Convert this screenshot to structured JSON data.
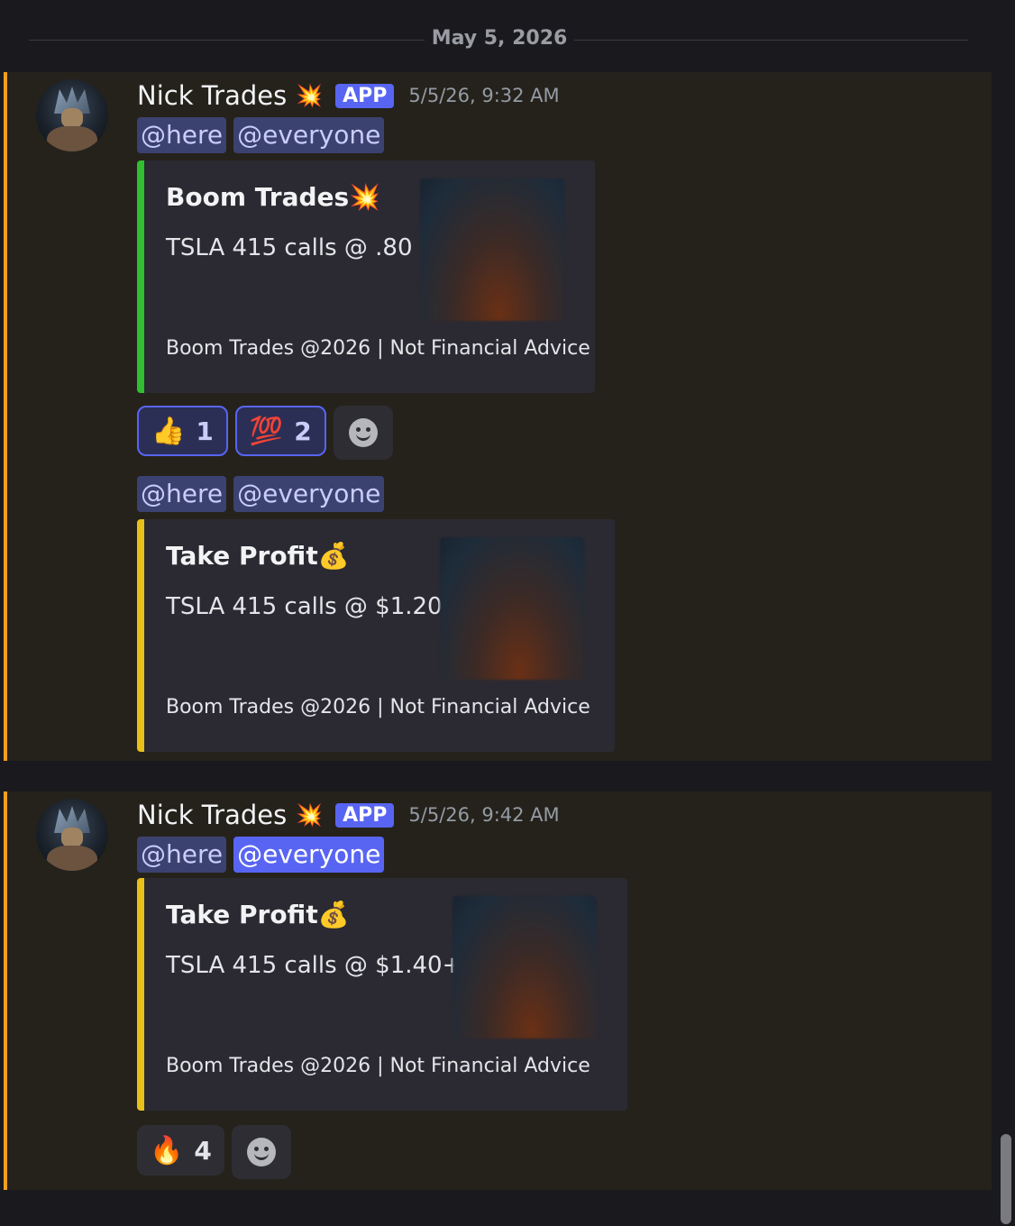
{
  "date_divider": "May 5, 2026",
  "messages": [
    {
      "author": "Nick Trades",
      "author_emoji": "💥",
      "badge": "APP",
      "timestamp": "5/5/26, 9:32 AM",
      "posts": [
        {
          "mentions": [
            "@here",
            "@everyone"
          ],
          "embed": {
            "title": "Boom Trades💥",
            "description": "TSLA 415 calls @ .80",
            "footer": "Boom Trades @2026 | Not Financial Advice",
            "color": "#2fbf2f"
          },
          "reactions": [
            {
              "emoji": "👍",
              "emoji_name": "thumbs-up-icon",
              "count": "1"
            },
            {
              "emoji": "💯",
              "emoji_name": "hundred-points-icon",
              "count": "2"
            }
          ]
        },
        {
          "mentions": [
            "@here",
            "@everyone"
          ],
          "embed": {
            "title": "Take Profit💰",
            "description": "TSLA 415 calls @ $1.20",
            "footer": "Boom Trades @2026 | Not Financial Advice",
            "color": "#e8c01a"
          }
        }
      ]
    },
    {
      "author": "Nick Trades",
      "author_emoji": "💥",
      "badge": "APP",
      "timestamp": "5/5/26, 9:42 AM",
      "posts": [
        {
          "mentions": [
            "@here",
            "@everyone"
          ],
          "embed": {
            "title": "Take Profit💰",
            "description": "TSLA 415 calls @ $1.40+",
            "footer": "Boom Trades @2026 | Not Financial Advice",
            "color": "#e8c01a"
          },
          "reactions": [
            {
              "emoji": "🔥",
              "emoji_name": "fire-icon",
              "count": "4"
            }
          ]
        }
      ]
    }
  ],
  "colors": {
    "highlight_border": "#f0a020",
    "mention_bg": "#3c4270",
    "blurple": "#5865f2"
  }
}
